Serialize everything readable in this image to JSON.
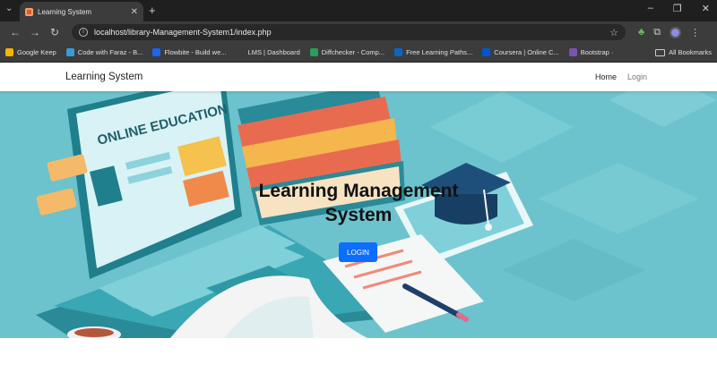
{
  "browser": {
    "tab_title": "Learning System",
    "url": "localhost/library-Management-System1/index.php",
    "bookmarks": [
      {
        "label": "Google Keep",
        "color": "#f4b400"
      },
      {
        "label": "Code with Faraz - B...",
        "color": "#3a9ad9"
      },
      {
        "label": "Flowbite - Build we...",
        "color": "#1c64f2"
      },
      {
        "label": "LMS | Dashboard",
        "color": "#3c3c3c"
      },
      {
        "label": "Diffchecker - Comp...",
        "color": "#2e9c5a"
      },
      {
        "label": "Free Learning Paths...",
        "color": "#0a66c2"
      },
      {
        "label": "Coursera | Online C...",
        "color": "#0056d2"
      },
      {
        "label": "Bootstrap ·",
        "color": "#7952b3"
      }
    ],
    "all_bookmarks": "All Bookmarks"
  },
  "site": {
    "brand": "Learning System",
    "nav": {
      "home": "Home",
      "login": "Login"
    },
    "hero": {
      "title_line1": "Learning Management",
      "title_line2": "System",
      "button": "LOGIN",
      "illustration_text": "ONLINE EDUCATION"
    }
  },
  "colors": {
    "accent": "#0d6efd",
    "hero_bg": "#6cc3cd"
  }
}
